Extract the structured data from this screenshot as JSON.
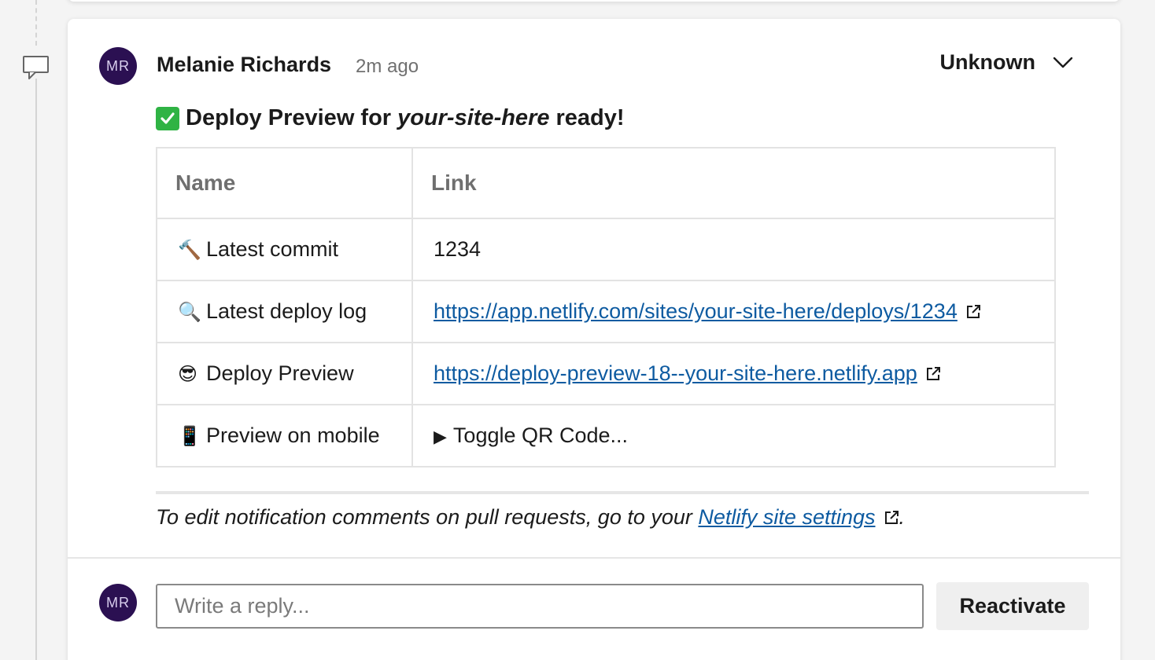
{
  "comment": {
    "author_initials": "MR",
    "author_name": "Melanie Richards",
    "timestamp": "2m ago",
    "status": "Unknown",
    "heading": {
      "prefix": "Deploy Preview for",
      "site": "your-site-here",
      "suffix": "ready!"
    },
    "table": {
      "headers": [
        "Name",
        "Link"
      ],
      "rows": [
        {
          "emoji": "🔨",
          "name": "Latest commit",
          "value": "1234"
        },
        {
          "emoji": "🔍",
          "name": "Latest deploy log",
          "value": "https://app.netlify.com/sites/your-site-here/deploys/1234"
        },
        {
          "emoji": "😎",
          "name": "Deploy Preview",
          "value": "https://deploy-preview-18--your-site-here.netlify.app"
        },
        {
          "emoji": "📱",
          "name": "Preview on mobile",
          "value": "Toggle QR Code..."
        }
      ]
    },
    "footnote": {
      "text": "To edit notification comments on pull requests, go to your",
      "link": "Netlify site settings",
      "end": "."
    }
  },
  "reply": {
    "avatar_initials": "MR",
    "placeholder": "Write a reply...",
    "button_label": "Reactivate"
  },
  "colors": {
    "avatar_bg": "#2b1052",
    "link": "#0e5ba1",
    "check_green": "#2fb344"
  },
  "icons": [
    "comment-thread-icon",
    "chevron-down-icon",
    "check-mark-icon",
    "external-link-icon",
    "disclosure-triangle-icon"
  ]
}
